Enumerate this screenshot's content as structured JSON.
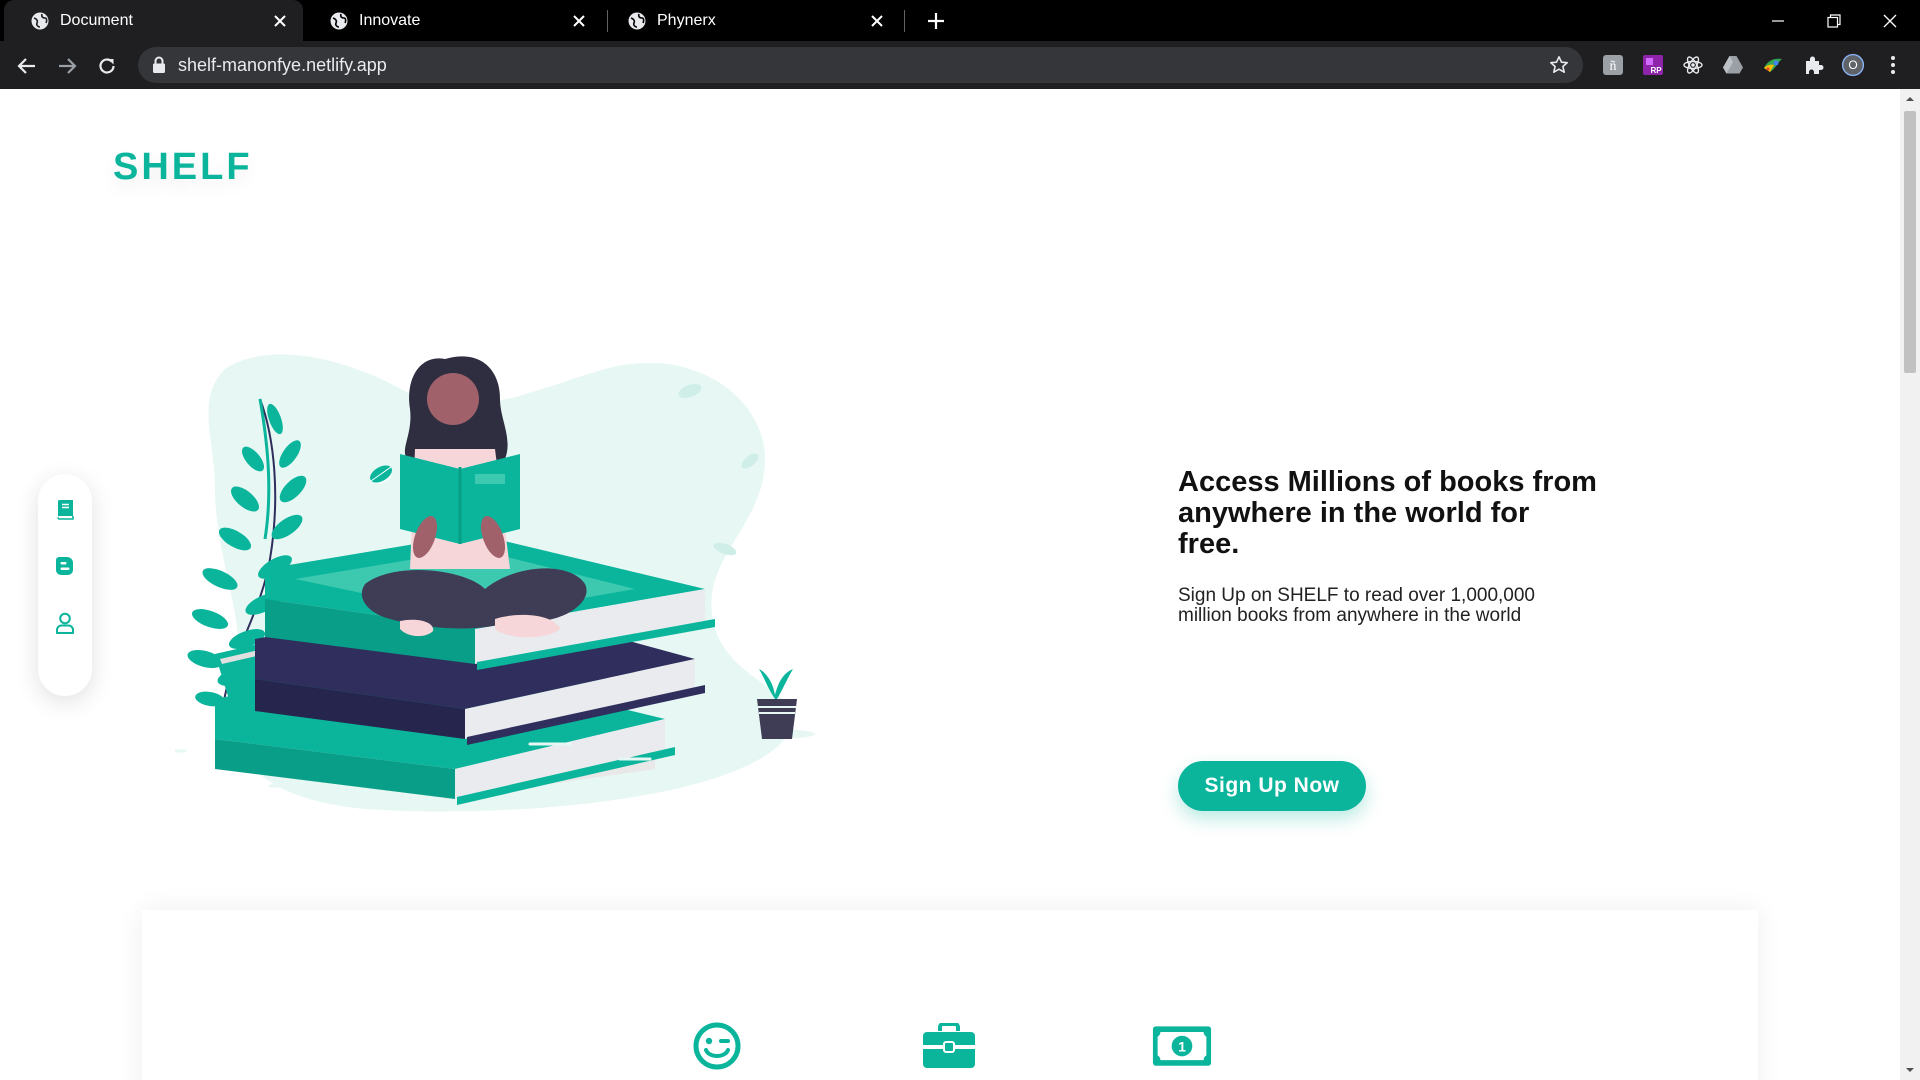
{
  "browser": {
    "tabs": [
      {
        "title": "Document",
        "active": true
      },
      {
        "title": "Innovate",
        "active": false
      },
      {
        "title": "Phynerx",
        "active": false
      }
    ],
    "url": "shelf-manonfye.netlify.app",
    "profile_initial": "O",
    "extensions": [
      "notion-extension-icon",
      "rp-extension-icon",
      "react-devtools-icon",
      "google-drive-icon",
      "color-picker-extension-icon",
      "puzzle-extensions-icon"
    ]
  },
  "page": {
    "logo": "SHELF",
    "hero": {
      "title": "Access Millions of books from anywhere in the world for free.",
      "subtitle": "Sign Up on SHELF to read over 1,000,000 million books from anywhere in the world",
      "cta": "Sign Up Now"
    },
    "sidenav": [
      "book-icon",
      "blog-icon",
      "user-icon"
    ],
    "features": [
      "smile-icon",
      "briefcase-icon",
      "money-icon"
    ]
  },
  "colors": {
    "accent": "#0ab59c",
    "book_navy": "#2f2e5c",
    "chrome_dark": "#1f1f21"
  }
}
